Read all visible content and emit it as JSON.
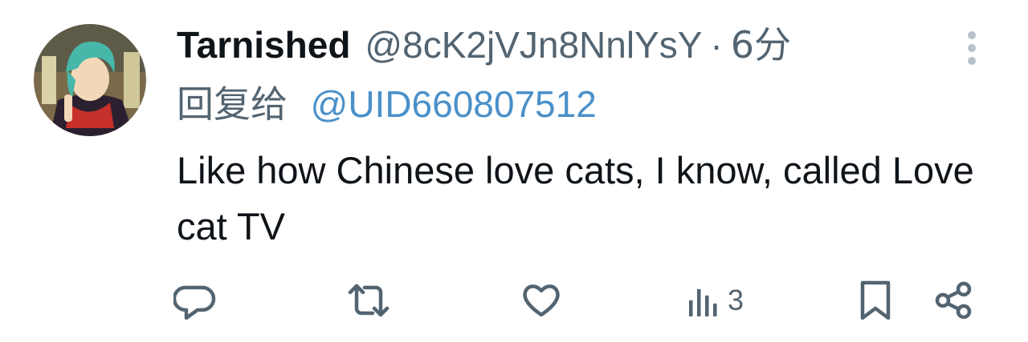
{
  "tweet": {
    "display_name": "Tarnished",
    "handle": "@8cK2jVJn8NnlYsY",
    "separator": "·",
    "time": "6分",
    "reply_prefix": "回复给",
    "reply_mention": "@UID660807512",
    "text": "Like how Chinese love cats, I know, called Love cat TV"
  },
  "actions": {
    "reply_icon": "speech-bubble-icon",
    "retweet_icon": "retweet-icon",
    "like_icon": "heart-icon",
    "views_icon": "bar-chart-icon",
    "views_count": "3",
    "bookmark_icon": "bookmark-icon",
    "share_icon": "share-icon"
  },
  "colors": {
    "primary_text": "#0f1419",
    "secondary_text": "#536471",
    "mention": "#4a90c9",
    "more_dots": "#b8c2cc"
  }
}
